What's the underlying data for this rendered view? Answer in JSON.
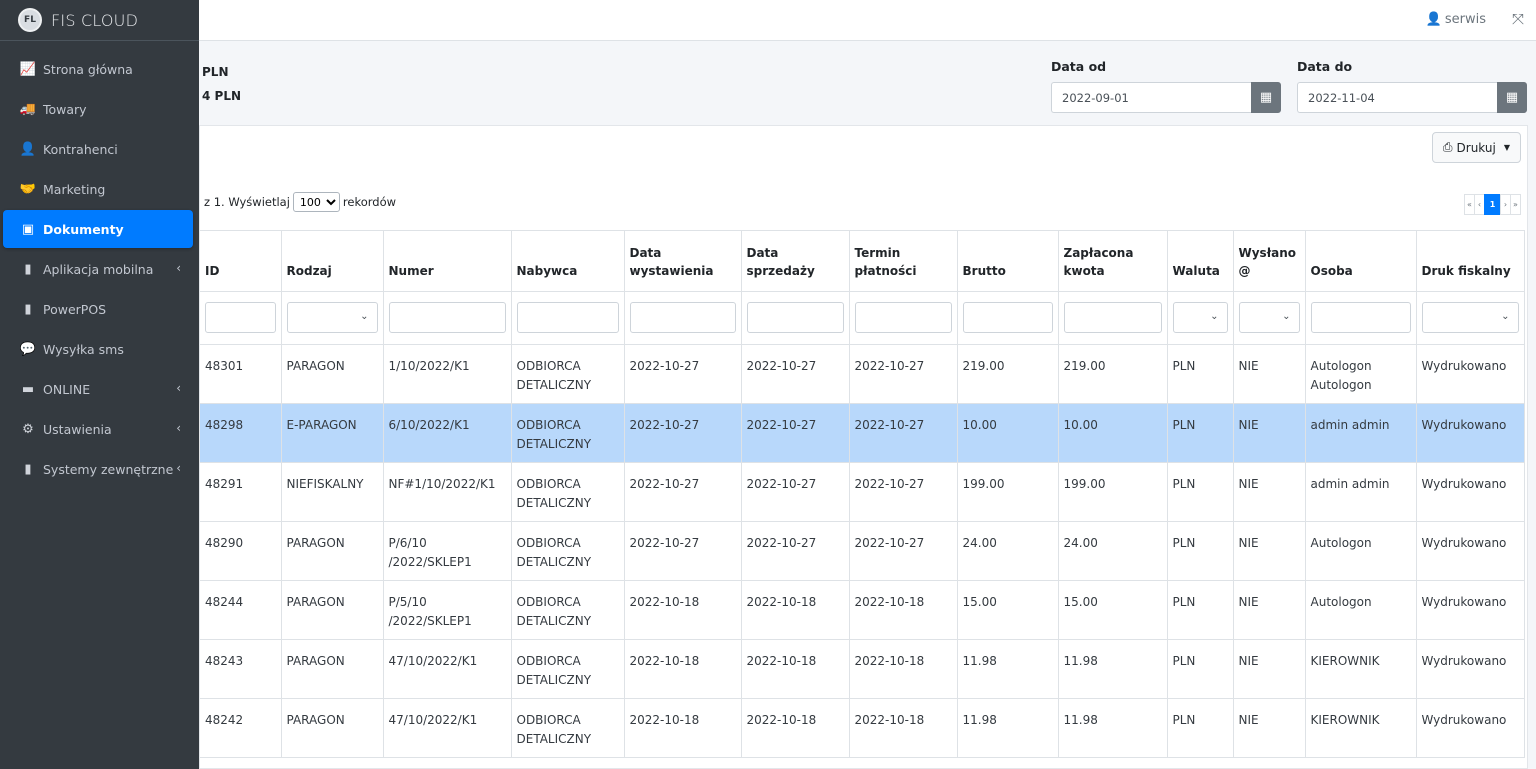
{
  "brand": {
    "title": "FIS CLOUD",
    "logo_text": "FL"
  },
  "sidebar": {
    "items": [
      {
        "label": "Strona główna",
        "icon": "chart-line-icon",
        "glyph": "📈",
        "chevron": false,
        "active": false
      },
      {
        "label": "Towary",
        "icon": "truck-icon",
        "glyph": "🚚",
        "chevron": false,
        "active": false
      },
      {
        "label": "Kontrahenci",
        "icon": "user-tie-icon",
        "glyph": "👤",
        "chevron": false,
        "active": false
      },
      {
        "label": "Marketing",
        "icon": "handshake-icon",
        "glyph": "🤝",
        "chevron": false,
        "active": false
      },
      {
        "label": "Dokumenty",
        "icon": "file-excel-icon",
        "glyph": "▣",
        "chevron": false,
        "active": true
      },
      {
        "label": "Aplikacja mobilna",
        "icon": "mobile-icon",
        "glyph": "▮",
        "chevron": true,
        "active": false
      },
      {
        "label": "PowerPOS",
        "icon": "tablet-icon",
        "glyph": "▮",
        "chevron": false,
        "active": false
      },
      {
        "label": "Wysyłka sms",
        "icon": "sms-icon",
        "glyph": "💬",
        "chevron": false,
        "active": false
      },
      {
        "label": "ONLINE",
        "icon": "store-icon",
        "glyph": "▬",
        "chevron": true,
        "active": false
      },
      {
        "label": "Ustawienia",
        "icon": "cogs-icon",
        "glyph": "⚙",
        "chevron": true,
        "active": false
      },
      {
        "label": "Systemy zewnętrzne",
        "icon": "bookmark-icon",
        "glyph": "▮",
        "chevron": true,
        "active": false
      }
    ],
    "chevron_glyph": "‹"
  },
  "topbar": {
    "user": "serwis",
    "user_glyph": "👤",
    "expand_glyph": "⤧"
  },
  "summary": {
    "line1": "PLN",
    "line2": "4 PLN"
  },
  "filters": {
    "date_from": {
      "label": "Data od",
      "value": "2022-09-01"
    },
    "date_to": {
      "label": "Data do",
      "value": "2022-11-04"
    },
    "calendar_glyph": "▦"
  },
  "toolbar": {
    "print_label": "Drukuj",
    "print_glyph": "⎙",
    "caret": "▼"
  },
  "records": {
    "prefix": "z 1. Wyświetlaj",
    "selected": "100",
    "suffix": "rekordów"
  },
  "pagination": {
    "first": "«",
    "prev": "‹",
    "current": "1",
    "next": "›",
    "last": "»"
  },
  "table": {
    "headers": [
      "ID",
      "Rodzaj",
      "Numer",
      "Nabywca",
      "Data wystawienia",
      "Data sprzedaży",
      "Termin płatności",
      "Brutto",
      "Zapłacona kwota",
      "Waluta",
      "Wysłano @",
      "Osoba",
      "Druk fiskalny"
    ],
    "rows": [
      [
        "48301",
        "PARAGON",
        "1/10/2022/K1",
        "ODBIORCA DETALICZNY",
        "2022-10-27",
        "2022-10-27",
        "2022-10-27",
        "219.00",
        "219.00",
        "PLN",
        "NIE",
        "Autologon Autologon",
        "Wydrukowano"
      ],
      [
        "48298",
        "E-PARAGON",
        "6/10/2022/K1",
        "ODBIORCA DETALICZNY",
        "2022-10-27",
        "2022-10-27",
        "2022-10-27",
        "10.00",
        "10.00",
        "PLN",
        "NIE",
        "admin admin",
        "Wydrukowano"
      ],
      [
        "48291",
        "NIEFISKALNY",
        "NF#1/10/2022/K1",
        "ODBIORCA DETALICZNY",
        "2022-10-27",
        "2022-10-27",
        "2022-10-27",
        "199.00",
        "199.00",
        "PLN",
        "NIE",
        "admin admin",
        "Wydrukowano"
      ],
      [
        "48290",
        "PARAGON",
        "P/6/10 /2022/SKLEP1",
        "ODBIORCA DETALICZNY",
        "2022-10-27",
        "2022-10-27",
        "2022-10-27",
        "24.00",
        "24.00",
        "PLN",
        "NIE",
        "Autologon",
        "Wydrukowano"
      ],
      [
        "48244",
        "PARAGON",
        "P/5/10 /2022/SKLEP1",
        "ODBIORCA DETALICZNY",
        "2022-10-18",
        "2022-10-18",
        "2022-10-18",
        "15.00",
        "15.00",
        "PLN",
        "NIE",
        "Autologon",
        "Wydrukowano"
      ],
      [
        "48243",
        "PARAGON",
        "47/10/2022/K1",
        "ODBIORCA DETALICZNY",
        "2022-10-18",
        "2022-10-18",
        "2022-10-18",
        "11.98",
        "11.98",
        "PLN",
        "NIE",
        "KIEROWNIK",
        "Wydrukowano"
      ],
      [
        "48242",
        "PARAGON",
        "47/10/2022/K1",
        "ODBIORCA DETALICZNY",
        "2022-10-18",
        "2022-10-18",
        "2022-10-18",
        "11.98",
        "11.98",
        "PLN",
        "NIE",
        "KIEROWNIK",
        "Wydrukowano"
      ]
    ],
    "selected_row": 1,
    "filter_types": [
      "input",
      "select",
      "input",
      "input",
      "input",
      "input",
      "input",
      "input",
      "input",
      "select",
      "select",
      "input",
      "select"
    ],
    "select_chevron": "⌄"
  },
  "colors": {
    "sidebar": "#343a40",
    "accent": "#007bff",
    "selected_row": "#b8d8fb"
  }
}
